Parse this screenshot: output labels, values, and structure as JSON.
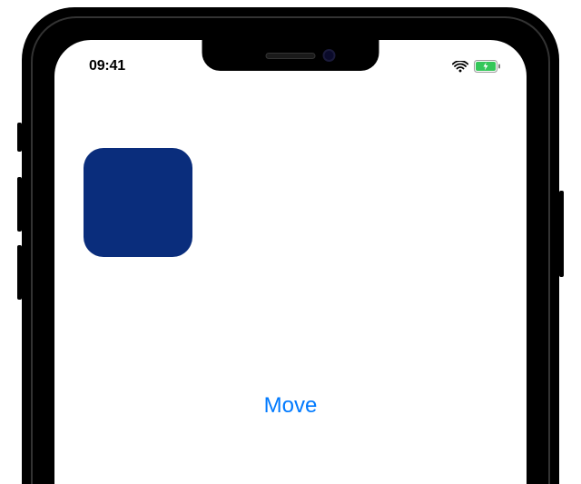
{
  "statusBar": {
    "time": "09:41"
  },
  "content": {
    "boxColor": "#0a2d7c",
    "buttonLabel": "Move",
    "buttonColor": "#007aff"
  }
}
